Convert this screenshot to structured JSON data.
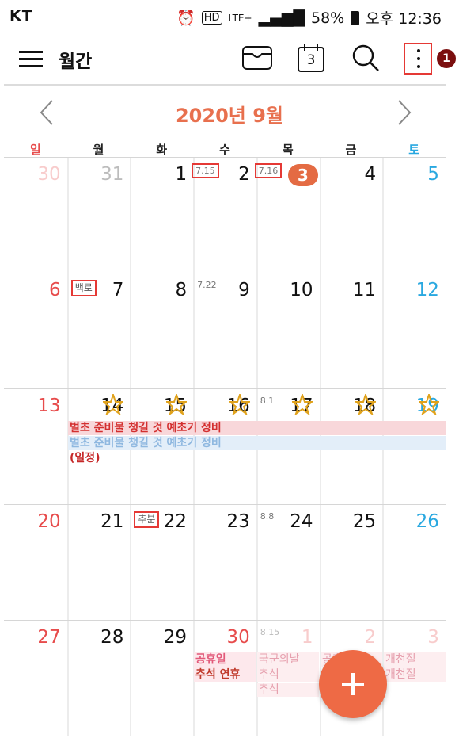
{
  "status": {
    "carrier": "KT",
    "network": "LTE+",
    "battery": "58%",
    "time": "오후 12:36",
    "icons": [
      "alarm-icon",
      "hd-icon",
      "signal-icon",
      "battery-icon"
    ]
  },
  "appbar": {
    "title": "월간",
    "icons": [
      "menu-icon",
      "inbox-icon",
      "today-icon",
      "search-icon",
      "more-icon"
    ],
    "today_icon_label": "3",
    "annotation_badge": "1"
  },
  "month": {
    "label": "2020년 9월"
  },
  "weekdays": [
    "일",
    "월",
    "화",
    "수",
    "목",
    "금",
    "토"
  ],
  "weeks": [
    {
      "days": [
        {
          "d": "30",
          "dim": true
        },
        {
          "d": "31",
          "dim": true
        },
        {
          "d": "1",
          "lunar": "7.15"
        },
        {
          "d": "2"
        },
        {
          "d": "3",
          "lunar": "7.16",
          "today": true
        },
        {
          "d": "4"
        },
        {
          "d": "5"
        }
      ]
    },
    {
      "days": [
        {
          "d": "6"
        },
        {
          "d": "7",
          "label": "백로"
        },
        {
          "d": "8"
        },
        {
          "d": "9",
          "lunar": "7.22"
        },
        {
          "d": "10"
        },
        {
          "d": "11"
        },
        {
          "d": "12"
        }
      ]
    },
    {
      "days": [
        {
          "d": "13"
        },
        {
          "d": "14",
          "star": true
        },
        {
          "d": "15",
          "star": true
        },
        {
          "d": "16",
          "star": true
        },
        {
          "d": "17",
          "lunar": "8.1",
          "star": true
        },
        {
          "d": "18",
          "star": true
        },
        {
          "d": "19",
          "star": true
        }
      ]
    },
    {
      "days": [
        {
          "d": "20"
        },
        {
          "d": "21"
        },
        {
          "d": "22",
          "label": "추분"
        },
        {
          "d": "23"
        },
        {
          "d": "24",
          "lunar": "8.8"
        },
        {
          "d": "25"
        },
        {
          "d": "26"
        }
      ]
    },
    {
      "days": [
        {
          "d": "27"
        },
        {
          "d": "28"
        },
        {
          "d": "29"
        },
        {
          "d": "30"
        },
        {
          "d": "1",
          "lunar": "8.15",
          "dim": true
        },
        {
          "d": "2",
          "dim": true
        },
        {
          "d": "3",
          "dim": true
        }
      ]
    }
  ],
  "events": {
    "week3_event1": "벌초 준비물 챙길 것 예초기 정비",
    "week3_event2": "벌초 준비물 챙길 것 예초기 정비",
    "week3_event3": "(일정)",
    "w5_wed_1": "공휴일",
    "w5_wed_2": "추석 연휴",
    "w5_thu_1": "국군의날",
    "w5_thu_2": "추석",
    "w5_thu_3": "추석",
    "w5_fri_1": "공휴일",
    "w5_sat_1": "개천절",
    "w5_sat_2": "개천절"
  },
  "colors": {
    "accent": "#e8704e",
    "sunday": "#e74c4c",
    "saturday": "#29a8e0",
    "event_red_bg": "#f8d7da",
    "event_red_text": "#d32f2f",
    "event_blue_bg": "#e3eef9",
    "event_blue_text": "#8fb8e0",
    "holiday_text": "#f08ca0",
    "holiday_bg": "#fde8ec"
  }
}
